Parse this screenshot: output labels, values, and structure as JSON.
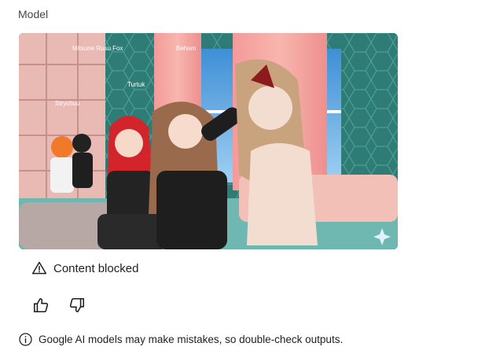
{
  "message": {
    "role_label": "Model",
    "image": {
      "description_icon": "sparkle-icon",
      "scene_labels": [
        "Mitsune Rusu Fox",
        "Beham",
        "Turtuk",
        "Strychuu"
      ]
    },
    "blocked_notice": {
      "icon": "warning-triangle-icon",
      "text": "Content blocked"
    },
    "feedback": {
      "thumbs_up_icon": "thumbs-up-icon",
      "thumbs_down_icon": "thumbs-down-icon"
    },
    "disclaimer": {
      "icon": "info-icon",
      "text": "Google AI models may make mistakes, so double-check outputs."
    }
  }
}
